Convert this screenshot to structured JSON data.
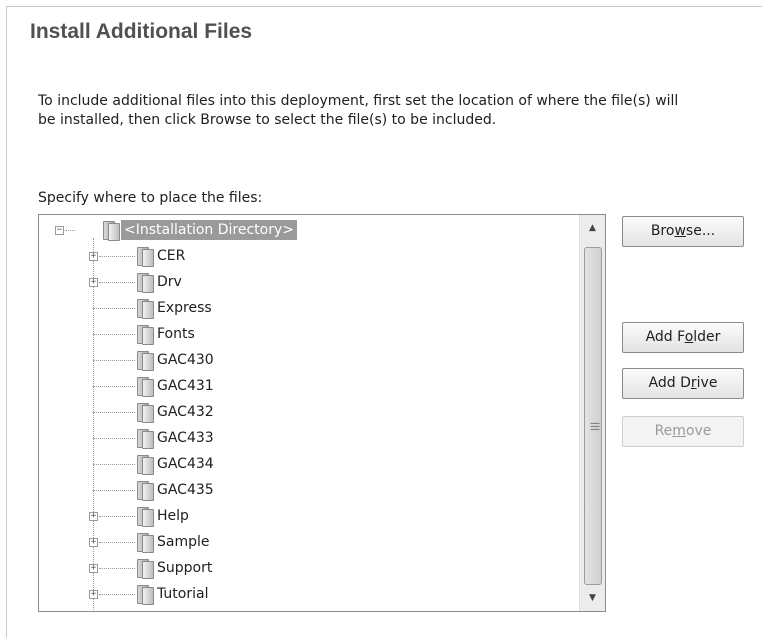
{
  "title": "Install Additional Files",
  "description": "To include additional files into this deployment, first set the location of where the file(s) will be installed, then click Browse to select the file(s) to be included.",
  "specify_label": "Specify where to place the files:",
  "tree": {
    "root": {
      "label": "<Installation Directory>",
      "expanded": true,
      "selected": true
    },
    "children": [
      {
        "label": "CER",
        "expandable": true
      },
      {
        "label": "Drv",
        "expandable": true
      },
      {
        "label": "Express",
        "expandable": false
      },
      {
        "label": "Fonts",
        "expandable": false
      },
      {
        "label": "GAC430",
        "expandable": false
      },
      {
        "label": "GAC431",
        "expandable": false
      },
      {
        "label": "GAC432",
        "expandable": false
      },
      {
        "label": "GAC433",
        "expandable": false
      },
      {
        "label": "GAC434",
        "expandable": false
      },
      {
        "label": "GAC435",
        "expandable": false
      },
      {
        "label": "Help",
        "expandable": true
      },
      {
        "label": "Sample",
        "expandable": true
      },
      {
        "label": "Support",
        "expandable": true
      },
      {
        "label": "Tutorial",
        "expandable": true
      }
    ]
  },
  "buttons": {
    "browse": {
      "pre": "Bro",
      "accel": "w",
      "post": "se...",
      "enabled": true
    },
    "add_folder": {
      "pre": "Add F",
      "accel": "o",
      "post": "lder",
      "enabled": true
    },
    "add_drive": {
      "pre": "Add D",
      "accel": "r",
      "post": "ive",
      "enabled": true
    },
    "remove": {
      "pre": "Re",
      "accel": "m",
      "post": "ove",
      "enabled": false
    }
  },
  "icons": {
    "folder": "folder-icon",
    "expand": "plus-expander-icon",
    "collapse": "minus-expander-icon",
    "scroll_up": "scroll-up-arrow-icon",
    "scroll_down": "scroll-down-arrow-icon"
  },
  "colors": {
    "selection": "#9a9a9a",
    "title": "#505050",
    "disabled_text": "#9a9a9a"
  }
}
